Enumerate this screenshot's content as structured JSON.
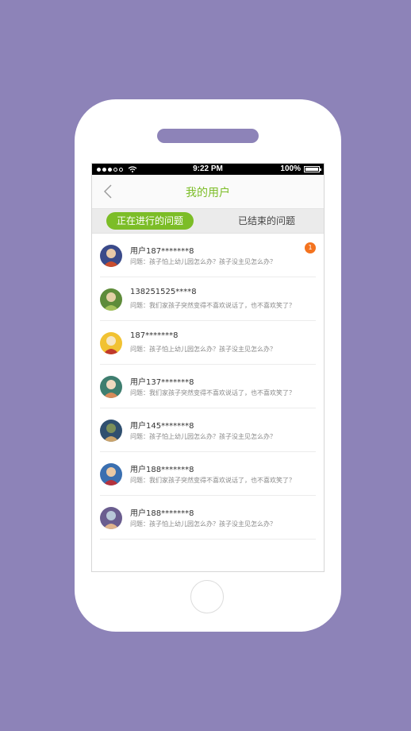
{
  "status_bar": {
    "time": "9:22 PM",
    "battery": "100%",
    "battery_level": 1.0
  },
  "nav": {
    "title": "我的用户",
    "back_icon": "chevron-left-icon"
  },
  "tabs": [
    {
      "label": "正在进行的问题",
      "active": true
    },
    {
      "label": "已结束的问题",
      "active": false
    }
  ],
  "items": [
    {
      "name": "用户187*******8",
      "question": "问题：孩子怕上幼儿园怎么办？孩子没主见怎么办？",
      "badge": "1",
      "avatar_colors": [
        "#3a4a8a",
        "#c94d2f",
        "#e8c9a8"
      ]
    },
    {
      "name": "138251525****8",
      "question": "问题：我们家孩子突然变得不喜欢说话了，也不喜欢笑了？",
      "badge": "",
      "avatar_colors": [
        "#5e8c3a",
        "#a5c25b",
        "#e4d0a6"
      ]
    },
    {
      "name": "187*******8",
      "question": "问题：孩子怕上幼儿园怎么办？孩子没主见怎么办？",
      "badge": "",
      "avatar_colors": [
        "#f1c232",
        "#c0392b",
        "#f6e7c5"
      ]
    },
    {
      "name": "用户137*******8",
      "question": "问题：我们家孩子突然变得不喜欢说话了，也不喜欢笑了？",
      "badge": "",
      "avatar_colors": [
        "#3e7e6f",
        "#d88b5a",
        "#f0d9bf"
      ]
    },
    {
      "name": "用户145*******8",
      "question": "问题：孩子怕上幼儿园怎么办？孩子没主见怎么办？",
      "badge": "",
      "avatar_colors": [
        "#2f4f6f",
        "#caa46c",
        "#7b8f5a"
      ]
    },
    {
      "name": "用户188*******8",
      "question": "问题：我们家孩子突然变得不喜欢说话了，也不喜欢笑了？",
      "badge": "",
      "avatar_colors": [
        "#3a6fb0",
        "#b5323c",
        "#e9c8a4"
      ]
    },
    {
      "name": "用户188*******8",
      "question": "问题：孩子怕上幼儿园怎么办？孩子没主见怎么办？",
      "badge": "",
      "avatar_colors": [
        "#6a5d8f",
        "#e0b48c",
        "#b8c8d8"
      ]
    }
  ],
  "colors": {
    "background": "#8d83b8",
    "accent": "#7cbd27",
    "badge": "#f4731f"
  }
}
